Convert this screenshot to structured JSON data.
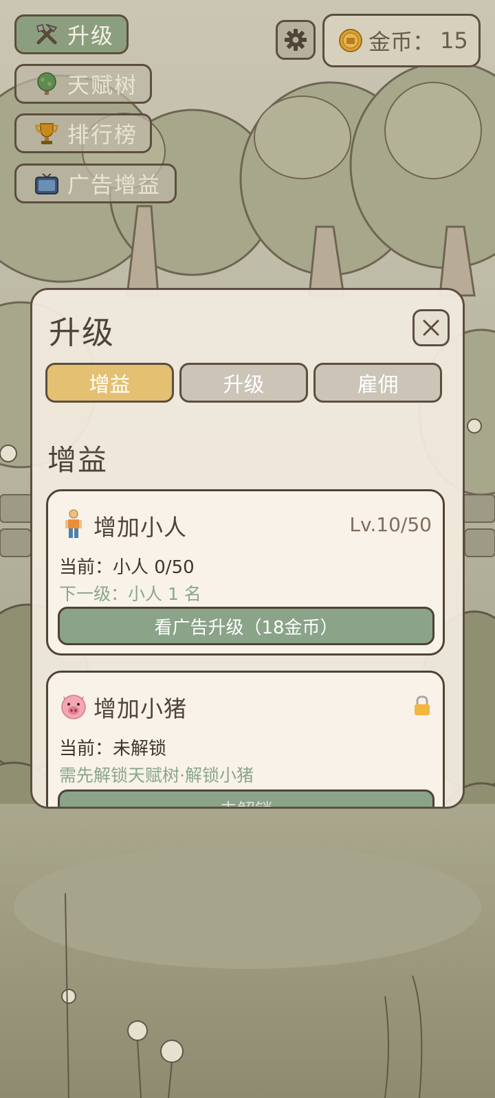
{
  "menu": {
    "upgrade_label": "升级",
    "talent_tree_label": "天赋树",
    "leaderboard_label": "排行榜",
    "ad_boost_label": "广告增益"
  },
  "coins": {
    "label": "金币：",
    "value": "15"
  },
  "panel": {
    "title": "升级",
    "tabs": [
      {
        "label": "增益",
        "active": true
      },
      {
        "label": "升级",
        "active": false
      },
      {
        "label": "雇佣",
        "active": false
      }
    ],
    "section_title": "增益",
    "cards": [
      {
        "icon": "person-icon",
        "title": "增加小人",
        "level": "Lv.10/50",
        "current": "当前：小人 0/50",
        "next": "下一级：小人 1 名",
        "button_label": "看广告升级（18金币）"
      },
      {
        "icon": "pig-icon",
        "title": "增加小猪",
        "status_icon": "lock-icon",
        "current": "当前：未解锁",
        "next": "需先解锁天赋树·解锁小猪",
        "button_label": "未解锁"
      }
    ]
  },
  "colors": {
    "accent_active_tab": "#e3c072",
    "button_green": "#8aa389",
    "border_brown": "#5c4e3f",
    "next_level_text": "#8aa689"
  }
}
